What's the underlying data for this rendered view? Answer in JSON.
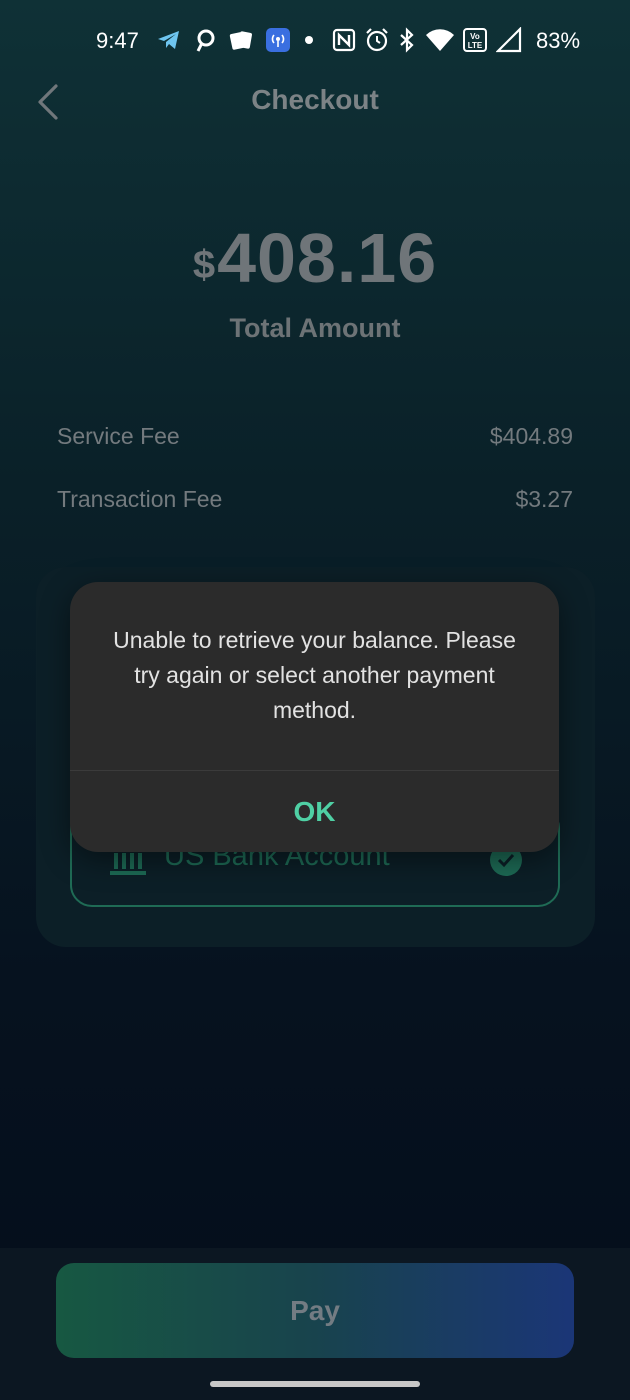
{
  "status_bar": {
    "time": "9:47",
    "battery": "83%",
    "icons": [
      "telegram-icon",
      "app-icon",
      "cards-icon",
      "nfc-broadcast-icon",
      "dot-icon",
      "nfc-icon",
      "alarm-icon",
      "bluetooth-icon",
      "wifi-icon",
      "volte-icon",
      "signal-icon"
    ]
  },
  "header": {
    "title": "Checkout",
    "back_icon": "chevron-left-icon"
  },
  "amount": {
    "currency": "$",
    "value": "408.16",
    "label": "Total Amount"
  },
  "fees": {
    "service": {
      "label": "Service Fee",
      "value": "$404.89"
    },
    "transaction": {
      "label": "Transaction Fee",
      "value": "$3.27"
    }
  },
  "payment_method": {
    "label": "US Bank Account",
    "icon": "bank-icon",
    "selected": true
  },
  "dialog": {
    "message": "Unable to retrieve your balance. Please try again or select another payment method.",
    "ok_label": "OK"
  },
  "footer": {
    "pay_label": "Pay"
  },
  "colors": {
    "accent": "#4fd0a4",
    "dialog_bg": "#2b2b2b",
    "bank_green": "#1d6a55",
    "pay_gradient_start": "#175842",
    "pay_gradient_end": "#1b3677"
  }
}
